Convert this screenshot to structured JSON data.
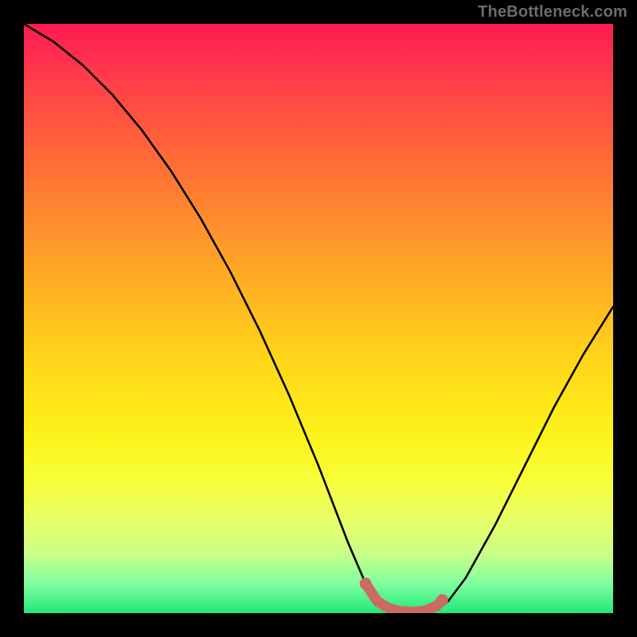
{
  "watermark": {
    "text": "TheBottleneck.com"
  },
  "colors": {
    "page_bg": "#000000",
    "curve": "#000000",
    "marker": "#cc6a63",
    "gradient_top": "#ff1a53",
    "gradient_bottom": "#22e77a"
  },
  "chart_data": {
    "type": "line",
    "title": "",
    "xlabel": "",
    "ylabel": "",
    "xlim": [
      0,
      100
    ],
    "ylim": [
      0,
      100
    ],
    "grid": false,
    "legend": false,
    "series": [
      {
        "name": "bottleneck-curve",
        "x": [
          0,
          5,
          10,
          15,
          20,
          25,
          30,
          35,
          40,
          45,
          50,
          55,
          58,
          60,
          62,
          65,
          68,
          70,
          72,
          75,
          80,
          85,
          90,
          95,
          100
        ],
        "y": [
          100,
          97,
          93,
          88,
          82,
          75,
          67,
          58,
          48,
          37,
          25,
          12,
          5,
          2,
          0.5,
          0,
          0,
          0.5,
          2,
          6,
          15,
          25,
          35,
          44,
          52
        ]
      }
    ],
    "highlight": {
      "name": "optimal-range",
      "x": [
        58,
        60,
        62,
        64,
        66,
        68,
        70,
        71
      ],
      "y": [
        5,
        2,
        0.8,
        0.3,
        0.2,
        0.4,
        1.2,
        2.2
      ]
    }
  }
}
